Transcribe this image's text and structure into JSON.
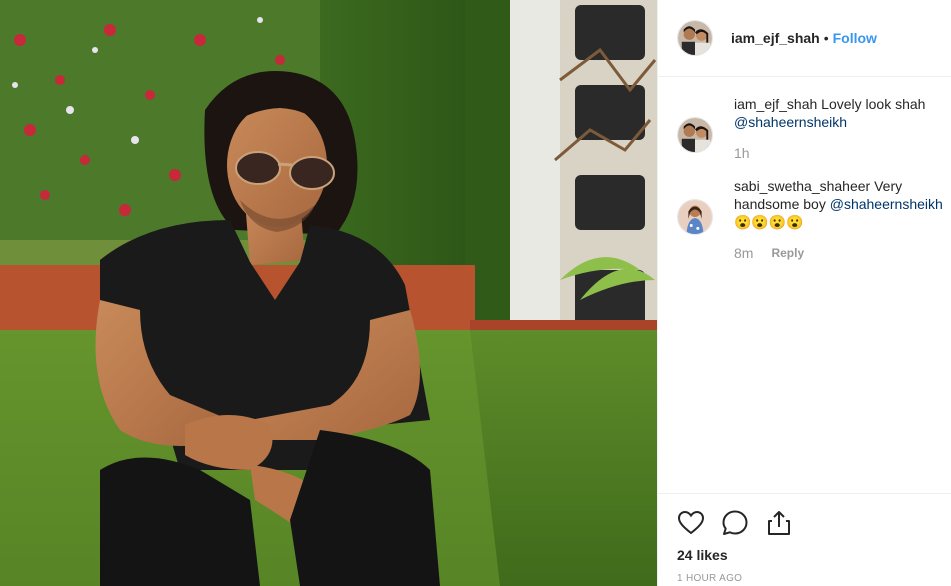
{
  "post": {
    "username": "iam_ejf_shah",
    "separator": "•",
    "follow_label": "Follow"
  },
  "comments": [
    {
      "username": "iam_ejf_shah",
      "text": "Lovely look shah",
      "mention": "@shaheernsheikh",
      "age": "1h"
    },
    {
      "username": "sabi_swetha_shaheer",
      "text": "Very handsome boy",
      "mention": "@shaheernsheikh",
      "emoji": "😮😮😮😮",
      "age": "8m",
      "reply_label": "Reply"
    }
  ],
  "footer": {
    "likes": "24 likes",
    "timestamp": "1 HOUR AGO"
  },
  "icons": {
    "like": "heart-icon",
    "comment": "comment-icon",
    "share": "share-icon"
  },
  "colors": {
    "link": "#3897f0",
    "mention": "#003569",
    "muted": "#999999",
    "text": "#262626"
  }
}
